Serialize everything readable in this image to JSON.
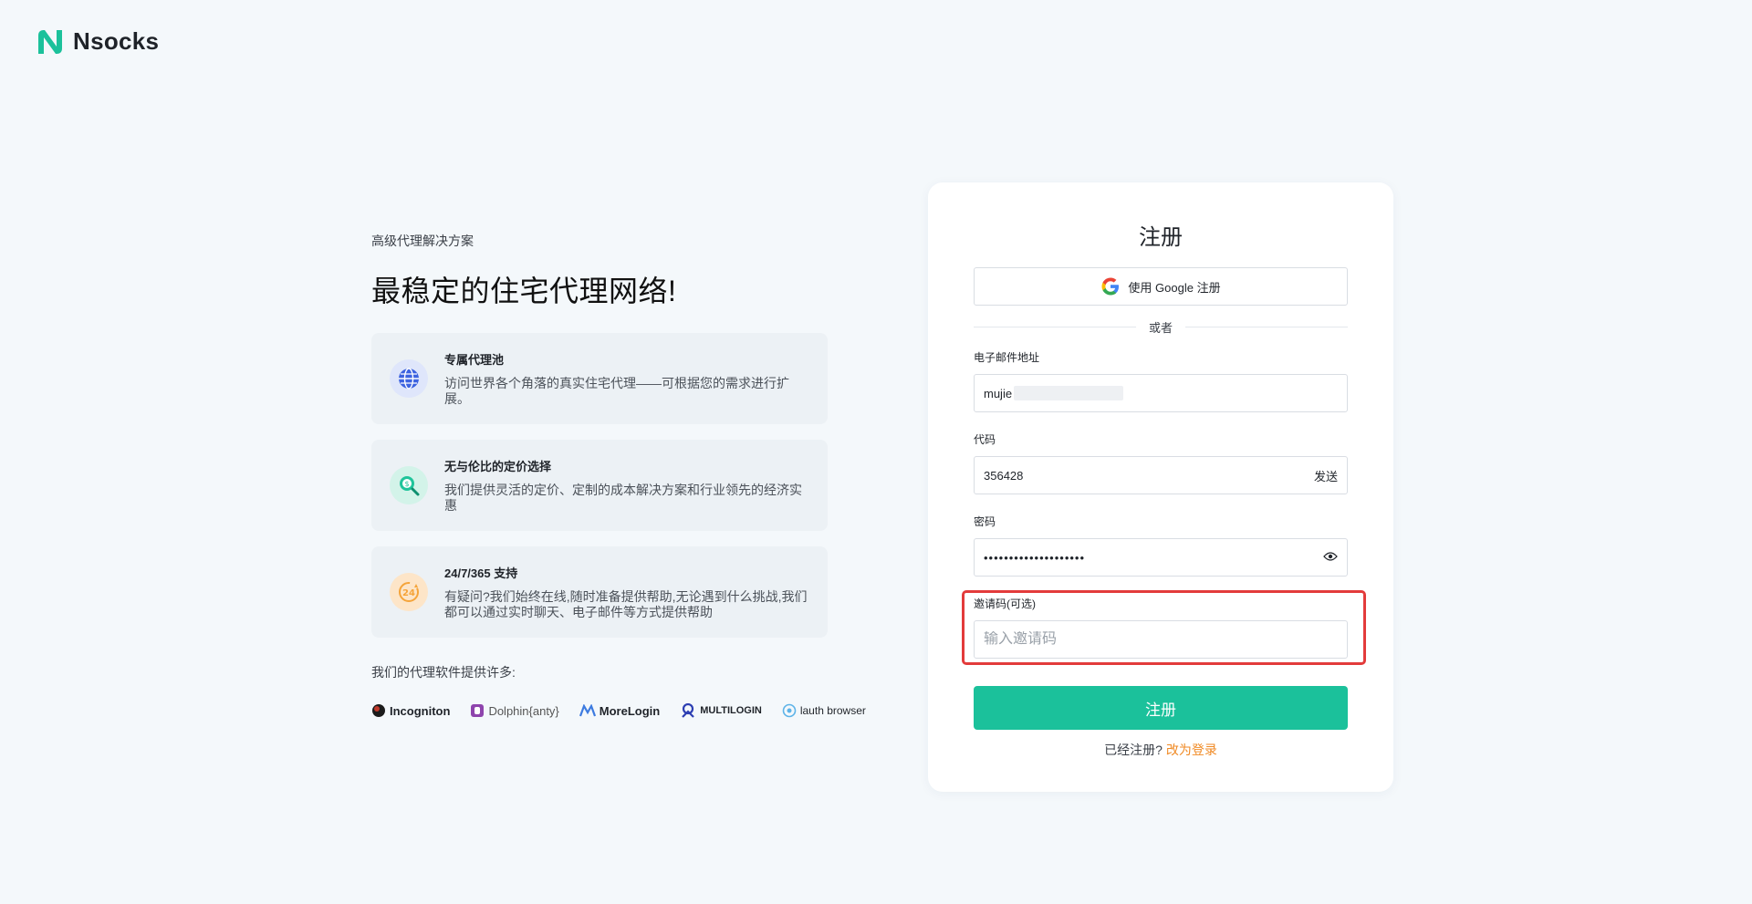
{
  "brand": {
    "name": "Nsocks",
    "accent": "#1bc19b"
  },
  "hero": {
    "eyebrow": "高级代理解决方案",
    "headline": "最稳定的住宅代理网络!"
  },
  "features": [
    {
      "icon": "globe-icon",
      "title": "专属代理池",
      "desc": "访问世界各个角落的真实住宅代理——可根据您的需求进行扩展。"
    },
    {
      "icon": "price-search-icon",
      "title": "无与伦比的定价选择",
      "desc": "我们提供灵活的定价、定制的成本解决方案和行业领先的经济实惠"
    },
    {
      "icon": "support-24-icon",
      "title": "24/7/365 支持",
      "desc": "有疑问?我们始终在线,随时准备提供帮助,无论遇到什么挑战,我们都可以通过实时聊天、电子邮件等方式提供帮助"
    }
  ],
  "partners": {
    "label": "我们的代理软件提供许多:",
    "items": [
      "Incogniton",
      "Dolphin{anty}",
      "MoreLogin",
      "MULTILOGIN",
      "lauth browser"
    ]
  },
  "form": {
    "title": "注册",
    "google_btn": "使用 Google 注册",
    "or": "或者",
    "email_label": "电子邮件地址",
    "email_value": "mujie",
    "code_label": "代码",
    "code_value": "356428",
    "send_label": "发送",
    "password_label": "密码",
    "password_value": "••••••••••••••••••••",
    "invite_label": "邀请码(可选)",
    "invite_placeholder": "输入邀请码",
    "submit": "注册",
    "already": "已经注册?",
    "login_link": "改为登录"
  }
}
